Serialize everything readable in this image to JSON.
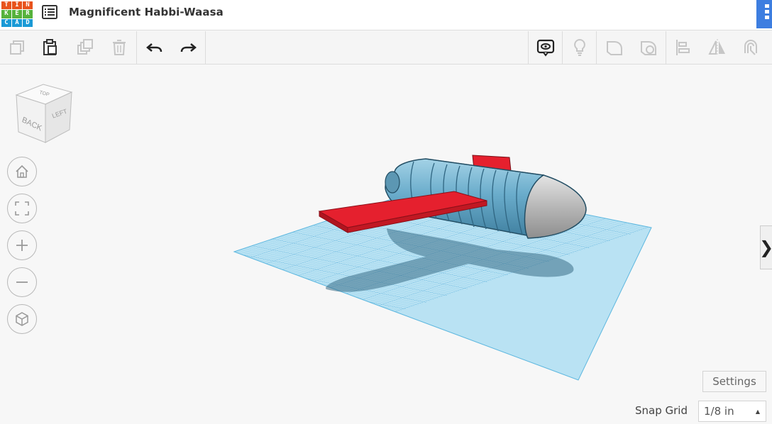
{
  "app": {
    "logo_letters": [
      "T",
      "I",
      "N",
      "K",
      "E",
      "R",
      "C",
      "A",
      "D"
    ],
    "logo_colors": [
      "#e8531c",
      "#e8531c",
      "#e8531c",
      "#56b23c",
      "#56b23c",
      "#56b23c",
      "#1b9ad6",
      "#1b9ad6",
      "#1b9ad6"
    ],
    "project_title": "Magnificent Habbi-Waasa",
    "accent": "#3d7ee0"
  },
  "toolbar": {
    "left_icons": [
      "copy-icon",
      "paste-icon",
      "duplicate-icon",
      "trash-icon",
      "undo-icon",
      "redo-icon"
    ],
    "right_icons": [
      "notes-icon",
      "light-bulb-icon",
      "solid-shape-icon",
      "hole-shape-icon",
      "align-icon",
      "mirror-icon",
      "workplane-icon"
    ]
  },
  "view_cube": {
    "front_label": "BACK",
    "side_label": "LEFT",
    "top_label": "TOP"
  },
  "nav_controls": [
    "home-view-icon",
    "fit-view-icon",
    "zoom-in-icon",
    "zoom-out-icon",
    "ortho-view-icon"
  ],
  "settings_label": "Settings",
  "snap_grid": {
    "label": "Snap Grid",
    "value": "1/8 in"
  },
  "right_panel_toggle": "❯",
  "colors": {
    "workplane": "#a7d8ee",
    "grid_line": "#5cb6dd",
    "body": "#5fa3c2",
    "nose": "#b9b9b9",
    "wing": "#e5202e"
  }
}
